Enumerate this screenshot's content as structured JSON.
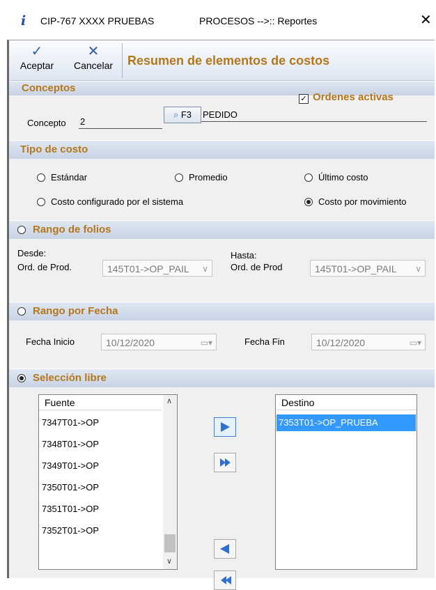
{
  "title_bar": {
    "app": "CIP-767 XXXX PRUEBAS",
    "module": "PROCESOS -->:: Reportes",
    "close": "✕"
  },
  "toolbar": {
    "accept_label": "Aceptar",
    "cancel_label": "Cancelar",
    "form_title": "Resumen de elementos de costos"
  },
  "conceptos": {
    "title": "Conceptos",
    "ordenes_activas_label": "Ordenes activas",
    "ordenes_activas_checked": true,
    "concepto_label": "Concepto",
    "concepto_value": "2",
    "f3_label": "F3",
    "concepto_desc": "PEDIDO"
  },
  "tipo_costo": {
    "title": "Tipo de costo",
    "options": [
      {
        "label": "Estándar",
        "selected": false
      },
      {
        "label": "Promedio",
        "selected": false
      },
      {
        "label": "Último costo",
        "selected": false
      },
      {
        "label": "Costo configurado por el sistema",
        "selected": false
      },
      {
        "label": "Costo por movimiento",
        "selected": true
      }
    ]
  },
  "rango_folios": {
    "title": "Rango de folios",
    "desde_label": "Desde:",
    "hasta_label": "Hasta:",
    "ord_prod_label_from": "Ord. de Prod.",
    "ord_prod_label_to": "Ord. de Prod",
    "from_value": "145T01->OP_PAIL",
    "to_value": "145T01->OP_PAIL"
  },
  "rango_fecha": {
    "title": "Rango por Fecha",
    "inicio_label": "Fecha Inicio",
    "inicio_value": "10/12/2020",
    "fin_label": "Fecha Fin",
    "fin_value": "10/12/2020"
  },
  "seleccion_libre": {
    "title": "Selección libre",
    "selected": true,
    "source_header": "Fuente",
    "source_items": [
      "7347T01->OP",
      "7348T01->OP",
      "7349T01->OP",
      "7350T01->OP",
      "7351T01->OP",
      "7352T01->OP"
    ],
    "dest_header": "Destino",
    "dest_items": [
      "7353T01->OP_PRUEBA"
    ]
  },
  "colors": {
    "accent": "#b5771c",
    "band": "#c8d3e4",
    "selection": "#3399ff",
    "icon_blue": "#2f6fd0"
  }
}
